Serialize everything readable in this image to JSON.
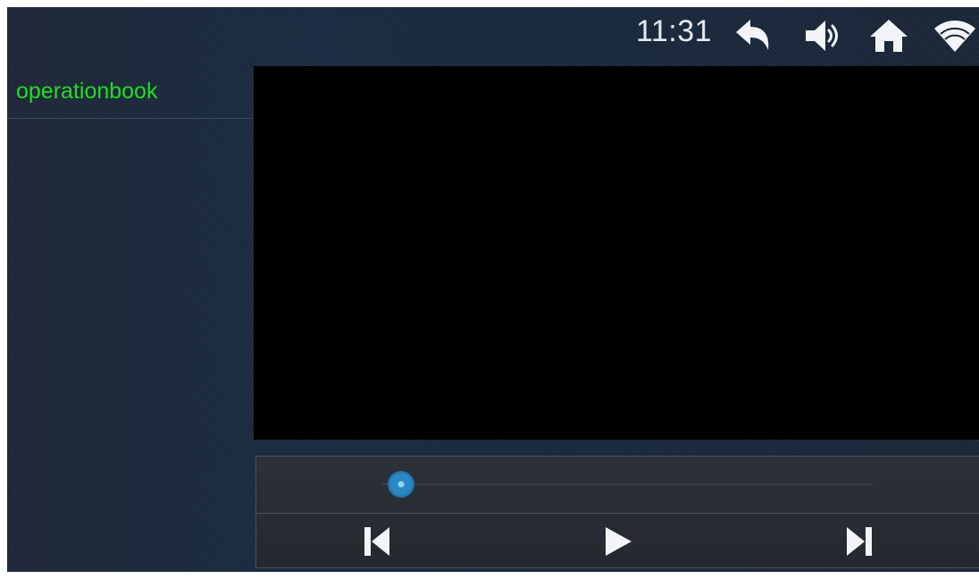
{
  "status_bar": {
    "time": "11:31",
    "icons": [
      "back-arrow-icon",
      "volume-icon",
      "home-icon",
      "wifi-icon"
    ]
  },
  "sidebar": {
    "items": [
      {
        "label": "operationbook",
        "selected": true
      }
    ]
  },
  "player": {
    "state": "paused",
    "progress_fraction": 0.04,
    "controls": [
      "previous-track-icon",
      "play-icon",
      "next-track-icon"
    ]
  },
  "colors": {
    "accent_green": "#22dd22",
    "seek_thumb": "#2a88c4",
    "background": "#1a2332"
  }
}
